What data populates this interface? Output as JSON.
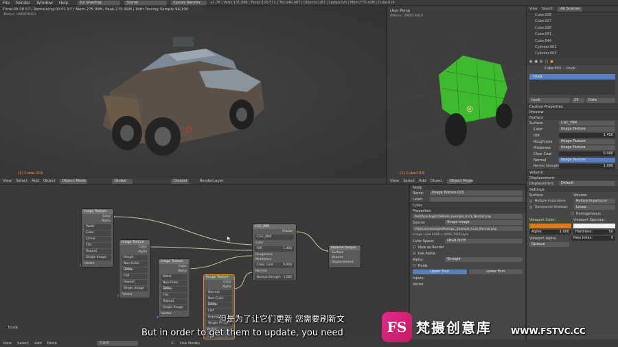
{
  "topbar": {
    "menu": [
      "File",
      "Render",
      "Window",
      "Help"
    ],
    "layout": "02 Shading",
    "scene": "Scene",
    "engine": "Cycles Render",
    "stats": "v2.78 | Verts:131,906 | Faces:120,512 | Tris:240,987 | Objects:1/67 | Lamps:0/3 | Mem:775.42M | Cube.019"
  },
  "viewport_left": {
    "render_status": "Time:00:38.57 | Remaining:00:01.97 | Mem:275.99M, Peak:275.99M | Path Tracing Sample 96/100",
    "unit": "(Meters: UNDEFINED)",
    "object_label": "(1) Cube.019"
  },
  "viewport_right": {
    "view_name": "User Persp",
    "unit": "(Meters: UNDEFINED)",
    "object_label": "(1) Cube.019"
  },
  "view3d_header": {
    "menus": [
      "View",
      "Select",
      "Add",
      "Object"
    ],
    "mode": "Object Mode",
    "orientation": "Global",
    "pivot": "Closest",
    "layer": "RenderLayer"
  },
  "view3d_header_right": {
    "menus": [
      "View",
      "Select",
      "Add",
      "Object"
    ],
    "mode": "Object Mode"
  },
  "outliner": {
    "header": [
      "View",
      "Search",
      "All Scenes"
    ],
    "items": [
      "Cube.026",
      "Cube.027",
      "Cube.028",
      "Cube.041",
      "Cube.044",
      "Cylinder.001",
      "Cylinder.002"
    ]
  },
  "node_editor": {
    "nodes": {
      "tex1": {
        "title": "Image Texture",
        "out1": "Color",
        "out2": "Alpha",
        "img": "Positi",
        "color": "Color",
        "interp": "Linear",
        "proj": "Flat",
        "ext": "Repeat",
        "src": "Single Image",
        "vec": "Vector"
      },
      "tex2": {
        "title": "Image Texture",
        "out1": "Color",
        "out2": "Alpha",
        "img": "Rough",
        "color": "Non-Color Data",
        "interp": "Linear",
        "proj": "Flat",
        "ext": "Repeat",
        "src": "Single Image",
        "vec": "Vector"
      },
      "tex3": {
        "title": "Image Texture",
        "out1": "Color",
        "out2": "Alpha",
        "img": "Metal",
        "color": "Non-Color Data",
        "interp": "Linear",
        "proj": "Flat",
        "ext": "Repeat",
        "src": "Single Image",
        "vec": "Vector"
      },
      "tex4": {
        "title": "Image Texture",
        "out1": "Color",
        "out2": "Alpha",
        "img": "Normal",
        "color": "Non-Color Data",
        "interp": "Linear",
        "proj": "Flat",
        "ext": "Repeat",
        "src": "Single Image",
        "vec": "Vector"
      },
      "pbr": {
        "title": "CGC_PBR",
        "out": "Shader",
        "group": "CGC_PBR",
        "in1": "Color",
        "in2": "IOR",
        "ior": "1.450",
        "in3": "Roughness",
        "in4": "Metalness",
        "in5": "Clear Coat",
        "cc": "0.000",
        "in6": "Normal",
        "in7": "Normal Strength",
        "ns": "1.000"
      },
      "out": {
        "title": "Material Output",
        "in1": "Surface",
        "in2": "Volume",
        "in3": "Displacement"
      }
    },
    "footer_object": "truck"
  },
  "node_header": {
    "menus": [
      "View",
      "Select",
      "Add",
      "Node"
    ],
    "material": "truck",
    "use_nodes": "Use Nodes"
  },
  "node_props": {
    "section_node": "Node",
    "name_label": "Name:",
    "name_value": "Image Texture.003",
    "label_label": "Label:",
    "color": "Color",
    "properties": "Properties",
    "image_path": "Post\\Apocalyptic\\Vehicle_Example_truck_Normal.png",
    "source_label": "Source:",
    "source": "Single Image",
    "filepath": "//textures\\example\\PostApo._Example_truck_Normal.png",
    "image_info": "Image: size 4096 x 4096, RGB byte",
    "color_space_label": "Color Space:",
    "color_space": "sRGB EOTF",
    "view_as_render": "View as Render",
    "use_alpha": "Use Alpha",
    "alpha_label": "Alpha:",
    "alpha": "Straight",
    "fields": "Fields",
    "upper_first": "Upper First",
    "lower_first": "Lower First",
    "inputs": "Inputs:",
    "vector": "Vector"
  },
  "properties": {
    "breadcrumb": [
      "Cube.033",
      "truck"
    ],
    "material_slot": "truck",
    "material_name": "truck",
    "users": "23",
    "data": "Data",
    "sections": {
      "custom": "Custom Properties",
      "preview": "Preview",
      "surface": "Surface",
      "volume": "Volume",
      "displacement": "Displacement",
      "settings": "Settings"
    },
    "surface_label": "Surface:",
    "surface_value": "CGC_PBR",
    "rows": [
      {
        "label": "Color",
        "value": "Image Texture"
      },
      {
        "label": "IOR",
        "value": "1.450"
      },
      {
        "label": "Roughness",
        "value": "Image Texture"
      },
      {
        "label": "Metalness",
        "value": "Image Texture"
      },
      {
        "label": "Clear Coat",
        "value": "0.000"
      },
      {
        "label": "Normal",
        "value": "Image Texture"
      },
      {
        "label": "Normal Strength",
        "value": "1.000"
      }
    ],
    "displacement_label": "Displacement:",
    "displacement_value": "Default",
    "settings": {
      "surface": "Surface:",
      "volume": "Volume:",
      "multiple_importance": "Multiple Importance",
      "transparent_shadows": "Transparent Shadows",
      "vol_sampling": "Multiple Importance",
      "vol_interp": "Linear",
      "homogeneous": "Homogeneous",
      "viewport_color": "Viewport Color:",
      "viewport_specular": "Viewport Specular:",
      "alpha": "Alpha:",
      "alpha_val": "1.000",
      "hardness": "Hardness:",
      "hardness_val": "50",
      "viewport_alpha": "Viewport Alpha:",
      "pass_index": "Pass Index:",
      "pass_index_val": "0",
      "opaque": "Opaque"
    }
  },
  "subtitles": {
    "zh": "但是为了让它们更新 您需要刷新文",
    "en": "But in order to get them to update, you need"
  },
  "watermark": {
    "brand_cn": "梵摄创意库",
    "url": "WWW.FSTVC.CC"
  },
  "colors": {
    "wire": "#4be03a",
    "viewport_orange": "#e07a10",
    "selection_blue": "#5680c2"
  }
}
